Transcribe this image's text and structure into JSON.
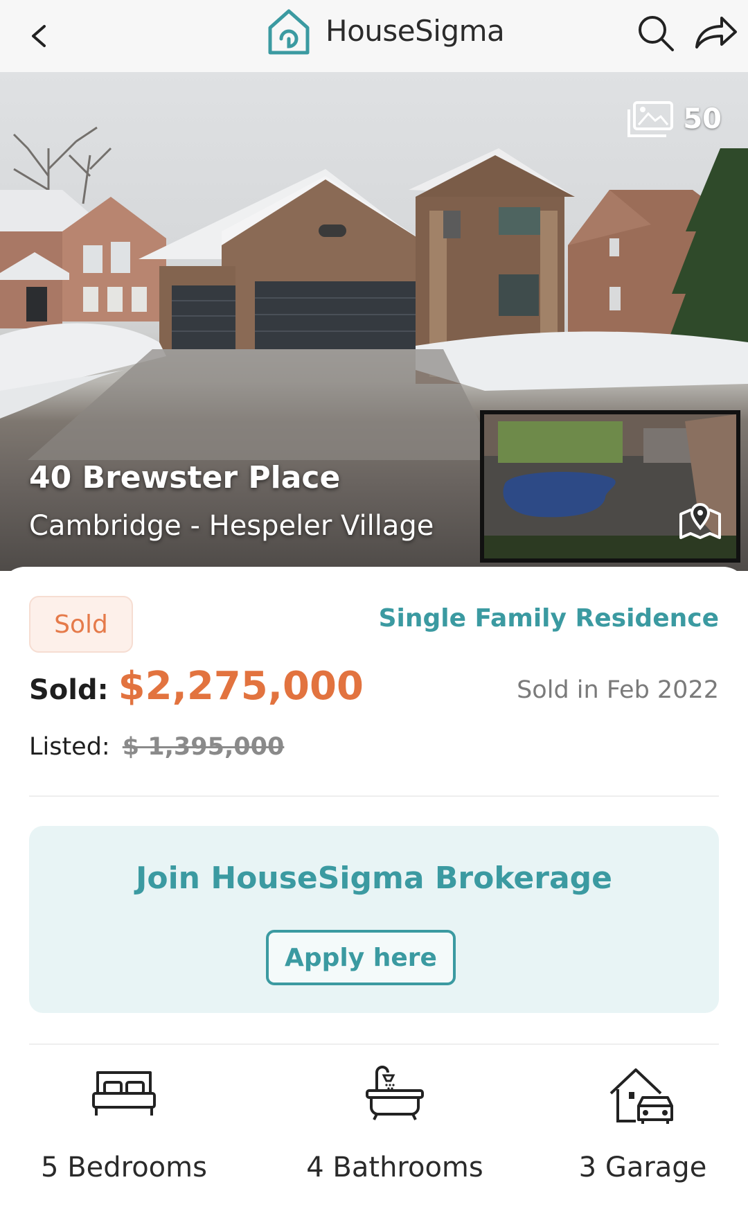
{
  "header": {
    "brand": "HouseSigma"
  },
  "gallery": {
    "photo_count": "50"
  },
  "listing": {
    "street": "40 Brewster Place",
    "area": "Cambridge - Hespeler Village",
    "status": "Sold",
    "property_type": "Single Family Residence",
    "sold_label": "Sold:",
    "sold_price": "$2,275,000",
    "sold_date": "Sold in Feb 2022",
    "listed_label": "Listed:",
    "listed_price": "$ 1,395,000"
  },
  "promo": {
    "title": "Join HouseSigma Brokerage",
    "button": "Apply here"
  },
  "features": [
    {
      "icon": "bed-icon",
      "label": "5 Bedrooms"
    },
    {
      "icon": "bathtub-icon",
      "label": "4 Bathrooms"
    },
    {
      "icon": "garage-icon",
      "label": "3 Garage"
    }
  ],
  "colors": {
    "accent_teal": "#3b9aa1",
    "price_orange": "#e2733f",
    "badge_bg": "#fdf0ea"
  }
}
